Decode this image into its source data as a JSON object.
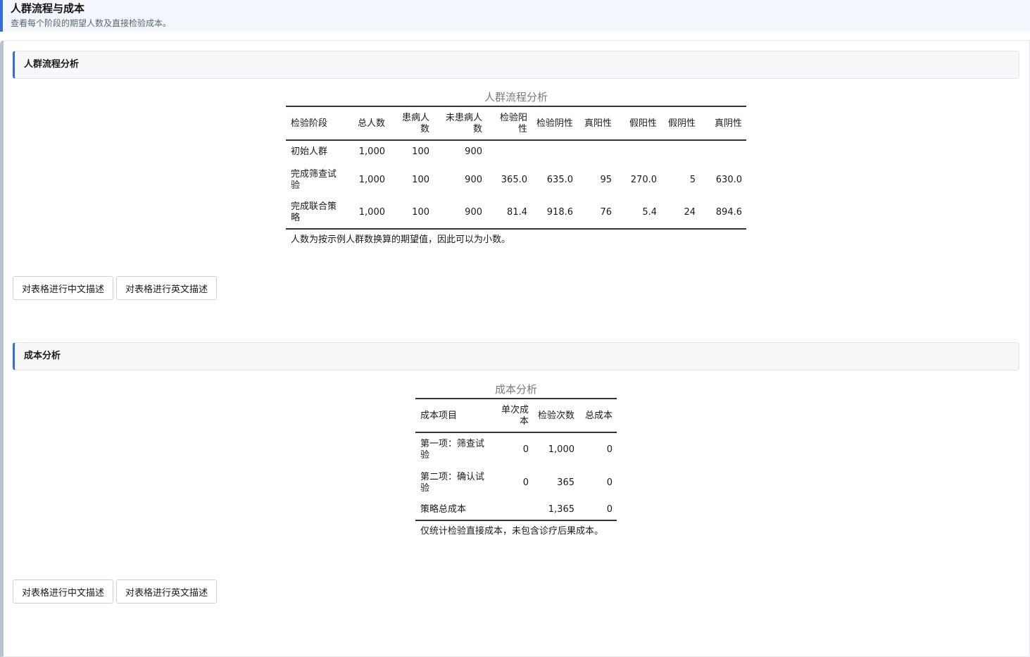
{
  "header": {
    "title": "人群流程与成本",
    "subtitle": "查看每个阶段的期望人数及直接检验成本。"
  },
  "flow": {
    "section_title": "人群流程分析",
    "caption": "人群流程分析",
    "columns": [
      "检验阶段",
      "总人数",
      "患病人数",
      "未患病人数",
      "检验阳性",
      "检验阴性",
      "真阳性",
      "假阳性",
      "假阴性",
      "真阴性"
    ],
    "rows": [
      [
        "初始人群",
        "1,000",
        "100",
        "900",
        "",
        "",
        "",
        "",
        "",
        ""
      ],
      [
        "完成筛查试验",
        "1,000",
        "100",
        "900",
        "365.0",
        "635.0",
        "95",
        "270.0",
        "5",
        "630.0"
      ],
      [
        "完成联合策略",
        "1,000",
        "100",
        "900",
        "81.4",
        "918.6",
        "76",
        "5.4",
        "24",
        "894.6"
      ]
    ],
    "note": "人数为按示例人群数换算的期望值，因此可以为小数。",
    "btn_cn": "对表格进行中文描述",
    "btn_en": "对表格进行英文描述"
  },
  "cost": {
    "section_title": "成本分析",
    "caption": "成本分析",
    "columns": [
      "成本项目",
      "单次成本",
      "检验次数",
      "总成本"
    ],
    "rows": [
      [
        "第一项：筛查试验",
        "0",
        "1,000",
        "0"
      ],
      [
        "第二项：确认试验",
        "0",
        "365",
        "0"
      ],
      [
        "策略总成本",
        "",
        "1,365",
        "0"
      ]
    ],
    "note": "仅统计检验直接成本，未包含诊疗后果成本。",
    "btn_cn": "对表格进行中文描述",
    "btn_en": "对表格进行英文描述"
  }
}
